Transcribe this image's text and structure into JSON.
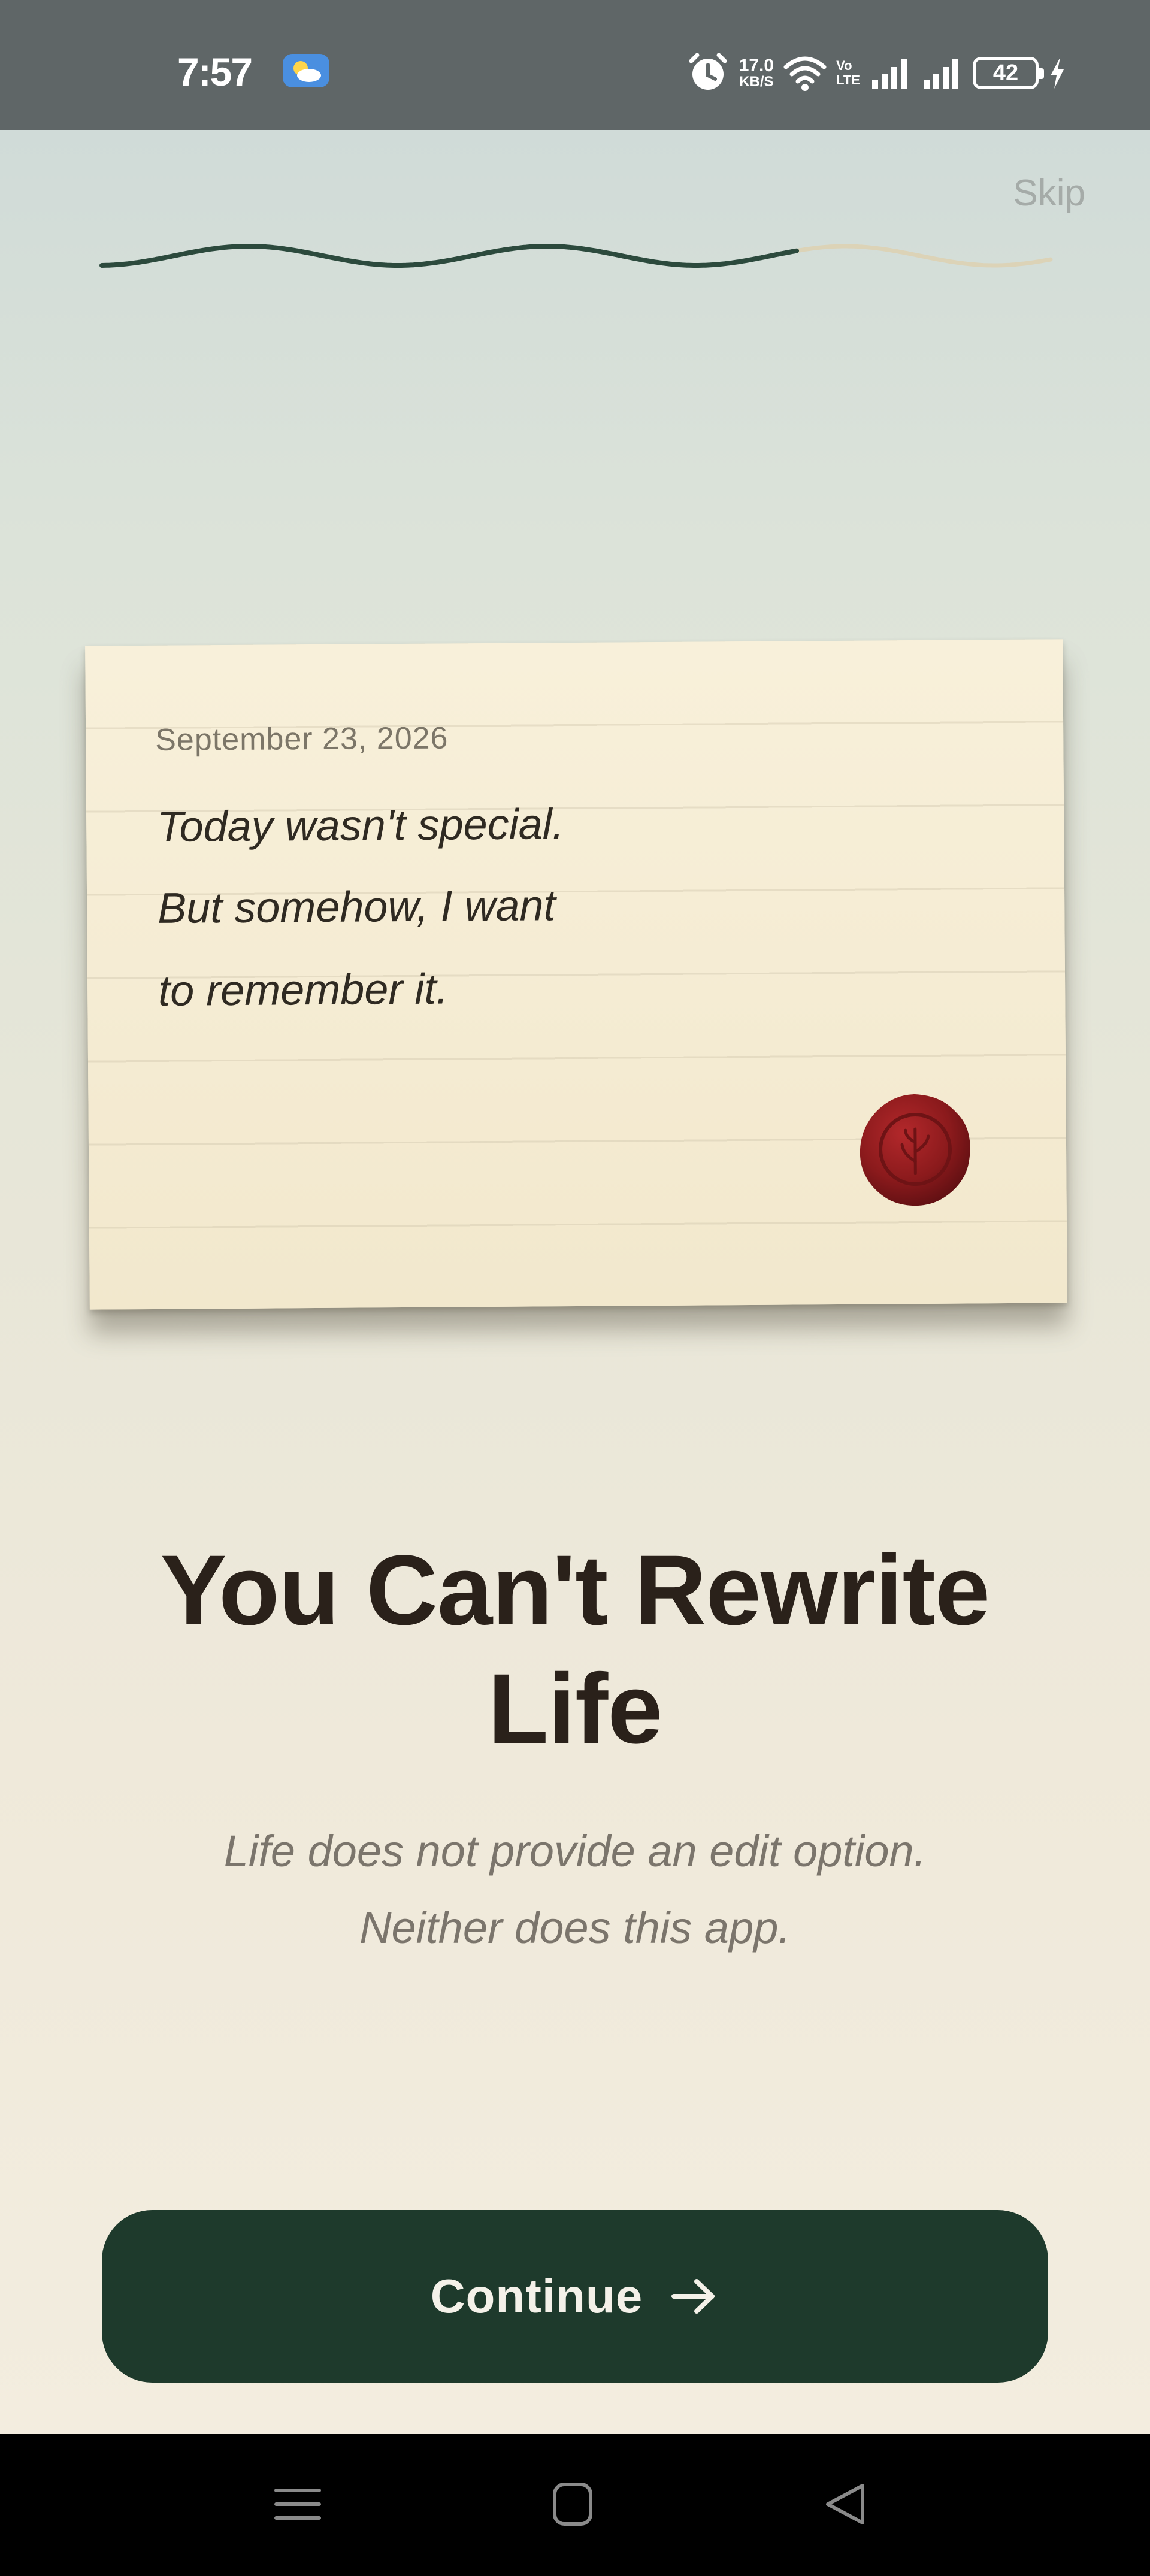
{
  "status_bar": {
    "time": "7:57",
    "net_speed_value": "17.0",
    "net_speed_unit": "KB/S",
    "volte_top": "Vo",
    "volte_bottom": "LTE",
    "battery_level": "42",
    "icons": [
      "weather-icon",
      "alarm-icon",
      "wifi-icon",
      "signal-icon",
      "signal-icon",
      "battery-icon",
      "charging-icon"
    ]
  },
  "onboarding": {
    "skip_label": "Skip",
    "progress_fraction": 0.73,
    "colors": {
      "progress_done": "#2c4a3d",
      "progress_remaining": "#dcd3b7",
      "accent": "#1e3a2c",
      "seal": "#8b1a1c"
    }
  },
  "note": {
    "date": "September 23, 2026",
    "lines": [
      "Today wasn't special.",
      "But somehow, I want",
      "to remember it."
    ],
    "seal_icon": "wax-seal-icon"
  },
  "headline": {
    "line1": "You Can't Rewrite",
    "line2": "Life"
  },
  "subtext": {
    "line1": "Life does not provide an edit option.",
    "line2": "Neither does this app."
  },
  "continue_button": {
    "label": "Continue",
    "icon": "arrow-right-icon"
  },
  "nav_bar": {
    "buttons": [
      "menu-icon",
      "home-icon",
      "back-icon"
    ]
  }
}
